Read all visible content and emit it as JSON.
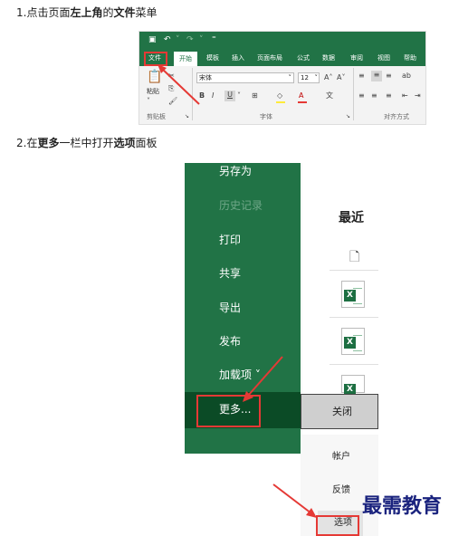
{
  "steps": {
    "step1": {
      "prefix": "1.点击页面",
      "bold1": "左上角",
      "mid": "的",
      "bold2": "文件",
      "suffix": "菜单"
    },
    "step2": {
      "prefix": "2.在",
      "bold1": "更多",
      "mid": "一栏中打开",
      "bold2": "选项",
      "suffix": "面板"
    }
  },
  "ribbon": {
    "tabs": [
      "文件",
      "开始",
      "模板",
      "插入",
      "页面布局",
      "公式",
      "数据",
      "审阅",
      "视图",
      "帮助"
    ],
    "active_tab": "开始",
    "font_name": "宋体",
    "font_size": "12",
    "paste_label": "粘贴",
    "clipboard_label": "剪贴板",
    "font_group_label": "字体",
    "align_group_label": "对齐方式",
    "bold": "B",
    "italic": "I",
    "underline": "U",
    "font_color": "A",
    "grow": "A˄",
    "shrink": "A˅"
  },
  "backstage": {
    "menu": [
      {
        "label": "另存为",
        "disabled": false
      },
      {
        "label": "历史记录",
        "disabled": true
      },
      {
        "label": "打印",
        "disabled": false
      },
      {
        "label": "共享",
        "disabled": false
      },
      {
        "label": "导出",
        "disabled": false
      },
      {
        "label": "发布",
        "disabled": false
      },
      {
        "label": "加载项 ˅",
        "disabled": false
      }
    ],
    "more_label": "更多...",
    "recent_title": "最近",
    "close_label": "关闭",
    "lower_items": [
      "帐户",
      "反馈"
    ],
    "options_label": "选项",
    "excel_icon_letter": "X"
  },
  "colors": {
    "excel_green": "#217346",
    "highlight": "#e53935",
    "dark_green": "#0b4b26"
  },
  "watermark": "最需教育"
}
